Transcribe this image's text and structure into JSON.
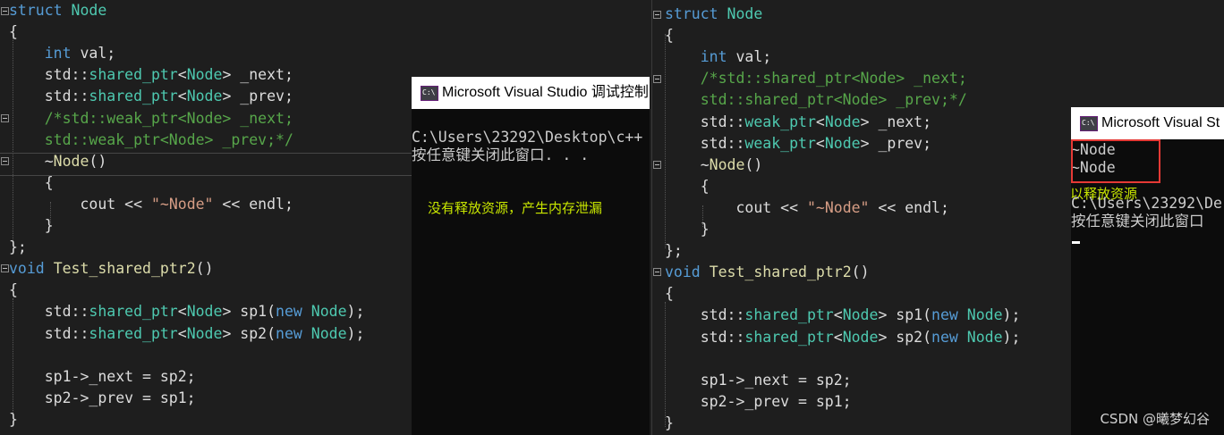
{
  "left_editor": {
    "lines": [
      {
        "parts": [
          [
            "kw",
            "struct"
          ],
          [
            "tx",
            " "
          ],
          [
            "ty",
            "Node"
          ]
        ]
      },
      {
        "parts": [
          [
            "tx",
            "{"
          ]
        ]
      },
      {
        "parts": [
          [
            "tx",
            "    "
          ],
          [
            "kw",
            "int"
          ],
          [
            "tx",
            " val;"
          ]
        ]
      },
      {
        "parts": [
          [
            "tx",
            "    std::"
          ],
          [
            "ty",
            "shared_ptr"
          ],
          [
            "tx",
            "<"
          ],
          [
            "ty",
            "Node"
          ],
          [
            "tx",
            "> _next;"
          ]
        ]
      },
      {
        "parts": [
          [
            "tx",
            "    std::"
          ],
          [
            "ty",
            "shared_ptr"
          ],
          [
            "tx",
            "<"
          ],
          [
            "ty",
            "Node"
          ],
          [
            "tx",
            "> _prev;"
          ]
        ]
      },
      {
        "parts": [
          [
            "cm",
            "    /*std::weak_ptr<Node> _next;"
          ]
        ]
      },
      {
        "parts": [
          [
            "cm",
            "    std::weak_ptr<Node> _prev;*/"
          ]
        ]
      },
      {
        "parts": [
          [
            "tx",
            "    ~"
          ],
          [
            "fn",
            "Node"
          ],
          [
            "tx",
            "()"
          ]
        ]
      },
      {
        "parts": [
          [
            "tx",
            "    {"
          ]
        ]
      },
      {
        "parts": [
          [
            "tx",
            "        cout << "
          ],
          [
            "st",
            "\"~Node\""
          ],
          [
            "tx",
            " << endl;"
          ]
        ]
      },
      {
        "parts": [
          [
            "tx",
            "    }"
          ]
        ]
      },
      {
        "parts": [
          [
            "tx",
            "};"
          ]
        ]
      },
      {
        "parts": [
          [
            "kw",
            "void"
          ],
          [
            "tx",
            " "
          ],
          [
            "fn",
            "Test_shared_ptr2"
          ],
          [
            "tx",
            "()"
          ]
        ]
      },
      {
        "parts": [
          [
            "tx",
            "{"
          ]
        ]
      },
      {
        "parts": [
          [
            "tx",
            "    std::"
          ],
          [
            "ty",
            "shared_ptr"
          ],
          [
            "tx",
            "<"
          ],
          [
            "ty",
            "Node"
          ],
          [
            "tx",
            "> sp1("
          ],
          [
            "kw",
            "new"
          ],
          [
            "tx",
            " "
          ],
          [
            "ty",
            "Node"
          ],
          [
            "tx",
            ");"
          ]
        ]
      },
      {
        "parts": [
          [
            "tx",
            "    std::"
          ],
          [
            "ty",
            "shared_ptr"
          ],
          [
            "tx",
            "<"
          ],
          [
            "ty",
            "Node"
          ],
          [
            "tx",
            "> sp2("
          ],
          [
            "kw",
            "new"
          ],
          [
            "tx",
            " "
          ],
          [
            "ty",
            "Node"
          ],
          [
            "tx",
            ");"
          ]
        ]
      },
      {
        "parts": [
          [
            "tx",
            ""
          ]
        ]
      },
      {
        "parts": [
          [
            "tx",
            "    sp1->_next = sp2;"
          ]
        ]
      },
      {
        "parts": [
          [
            "tx",
            "    sp2->_prev = sp1;"
          ]
        ]
      },
      {
        "parts": [
          [
            "tx",
            "}"
          ]
        ]
      }
    ]
  },
  "right_editor": {
    "lines": [
      {
        "parts": [
          [
            "kw",
            "struct"
          ],
          [
            "tx",
            " "
          ],
          [
            "ty",
            "Node"
          ]
        ]
      },
      {
        "parts": [
          [
            "tx",
            "{"
          ]
        ]
      },
      {
        "parts": [
          [
            "tx",
            "    "
          ],
          [
            "kw",
            "int"
          ],
          [
            "tx",
            " val;"
          ]
        ]
      },
      {
        "parts": [
          [
            "cm",
            "    /*std::shared_ptr<Node> _next;"
          ]
        ]
      },
      {
        "parts": [
          [
            "cm",
            "    std::shared_ptr<Node> _prev;*/"
          ]
        ]
      },
      {
        "parts": [
          [
            "tx",
            "    std::"
          ],
          [
            "ty",
            "weak_ptr"
          ],
          [
            "tx",
            "<"
          ],
          [
            "ty",
            "Node"
          ],
          [
            "tx",
            "> _next;"
          ]
        ]
      },
      {
        "parts": [
          [
            "tx",
            "    std::"
          ],
          [
            "ty",
            "weak_ptr"
          ],
          [
            "tx",
            "<"
          ],
          [
            "ty",
            "Node"
          ],
          [
            "tx",
            "> _prev;"
          ]
        ]
      },
      {
        "parts": [
          [
            "tx",
            "    ~"
          ],
          [
            "fn",
            "Node"
          ],
          [
            "tx",
            "()"
          ]
        ]
      },
      {
        "parts": [
          [
            "tx",
            "    {"
          ]
        ]
      },
      {
        "parts": [
          [
            "tx",
            "        cout << "
          ],
          [
            "st",
            "\"~Node\""
          ],
          [
            "tx",
            " << endl;"
          ]
        ]
      },
      {
        "parts": [
          [
            "tx",
            "    }"
          ]
        ]
      },
      {
        "parts": [
          [
            "tx",
            "};"
          ]
        ]
      },
      {
        "parts": [
          [
            "kw",
            "void"
          ],
          [
            "tx",
            " "
          ],
          [
            "fn",
            "Test_shared_ptr2"
          ],
          [
            "tx",
            "()"
          ]
        ]
      },
      {
        "parts": [
          [
            "tx",
            "{"
          ]
        ]
      },
      {
        "parts": [
          [
            "tx",
            "    std::"
          ],
          [
            "ty",
            "shared_ptr"
          ],
          [
            "tx",
            "<"
          ],
          [
            "ty",
            "Node"
          ],
          [
            "tx",
            "> sp1("
          ],
          [
            "kw",
            "new"
          ],
          [
            "tx",
            " "
          ],
          [
            "ty",
            "Node"
          ],
          [
            "tx",
            ");"
          ]
        ]
      },
      {
        "parts": [
          [
            "tx",
            "    std::"
          ],
          [
            "ty",
            "shared_ptr"
          ],
          [
            "tx",
            "<"
          ],
          [
            "ty",
            "Node"
          ],
          [
            "tx",
            "> sp2("
          ],
          [
            "kw",
            "new"
          ],
          [
            "tx",
            " "
          ],
          [
            "ty",
            "Node"
          ],
          [
            "tx",
            ");"
          ]
        ]
      },
      {
        "parts": [
          [
            "tx",
            ""
          ]
        ]
      },
      {
        "parts": [
          [
            "tx",
            "    sp1->_next = sp2;"
          ]
        ]
      },
      {
        "parts": [
          [
            "tx",
            "    sp2->_prev = sp1;"
          ]
        ]
      },
      {
        "parts": [
          [
            "tx",
            "}"
          ]
        ]
      }
    ]
  },
  "console_left": {
    "title": "Microsoft Visual Studio 调试控制",
    "lines": [
      "C:\\Users\\23292\\Desktop\\c++",
      "按任意键关闭此窗口. . ."
    ],
    "annotation": "没有释放资源，产生内存泄漏"
  },
  "console_right": {
    "title": "Microsoft Visual St",
    "output": [
      "~Node",
      "~Node"
    ],
    "lines": [
      "C:\\Users\\23292\\De",
      "按任意键关闭此窗口"
    ],
    "annotation": "可以释放资源"
  },
  "watermark": "CSDN @曦梦幻谷",
  "colors": {
    "accent_note": "#c8e600",
    "highlight_box": "#e53935",
    "editor_bg": "#1e1e1e",
    "console_bg": "#0c0c0c"
  }
}
